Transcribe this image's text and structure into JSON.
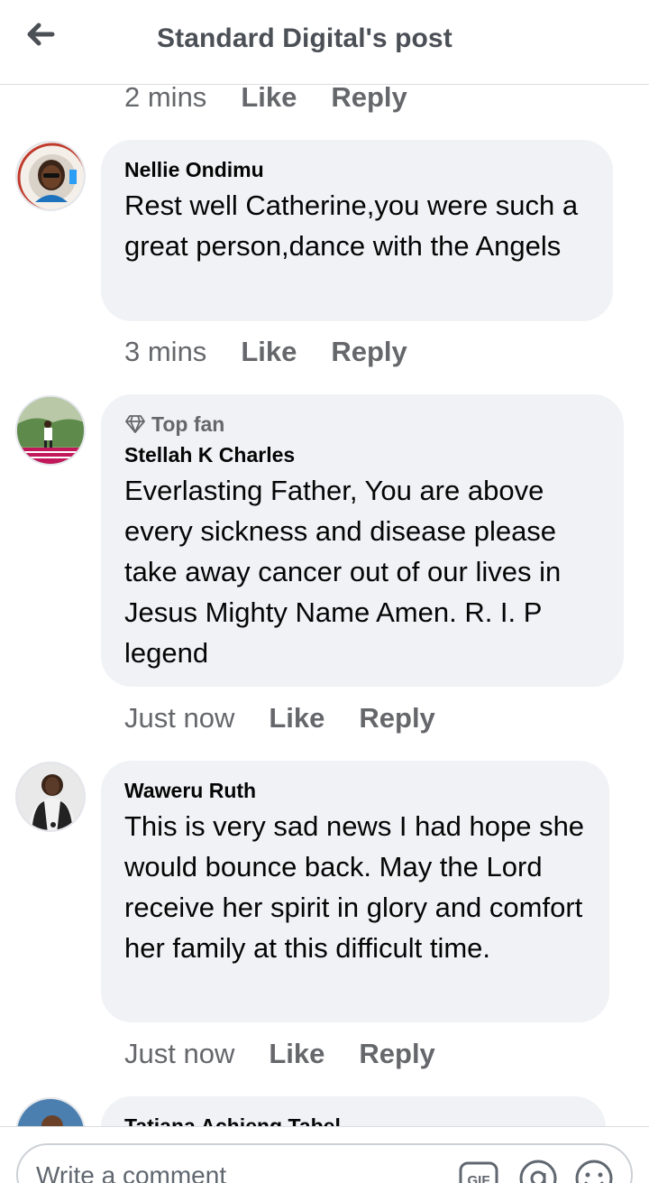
{
  "header": {
    "title": "Standard Digital's post"
  },
  "top_meta": {
    "time": "2 mins",
    "like": "Like",
    "reply": "Reply"
  },
  "comments": [
    {
      "author": "Nellie Ondimu",
      "badge": "",
      "text": "Rest well Catherine,you were such a great person,dance with the Angels",
      "time": "3 mins",
      "like": "Like",
      "reply": "Reply"
    },
    {
      "author": "Stellah K Charles",
      "badge": "Top fan",
      "text": "Everlasting Father, You are above every sickness and disease please take away cancer out of our lives in Jesus Mighty Name Amen. R. I. P legend",
      "time": "Just now",
      "like": "Like",
      "reply": "Reply"
    },
    {
      "author": "Waweru Ruth",
      "badge": "",
      "text": "This is very sad news I had hope she would bounce back. May the Lord receive her spirit in glory and comfort  her family at this difficult time.",
      "time": "Just now",
      "like": "Like",
      "reply": "Reply"
    },
    {
      "author": "Tatiana Achieng Tabel"
    }
  ],
  "composer": {
    "placeholder": "Write a comment",
    "gif_label": "GIF"
  },
  "icons": {
    "back": "arrow-left-icon",
    "top_fan": "diamond-icon",
    "gif": "gif-icon",
    "mention": "at-icon",
    "emoji": "emoji-icon"
  },
  "colors": {
    "bubble": "#f0f2f5",
    "meta": "#65676b",
    "text": "#050505"
  }
}
